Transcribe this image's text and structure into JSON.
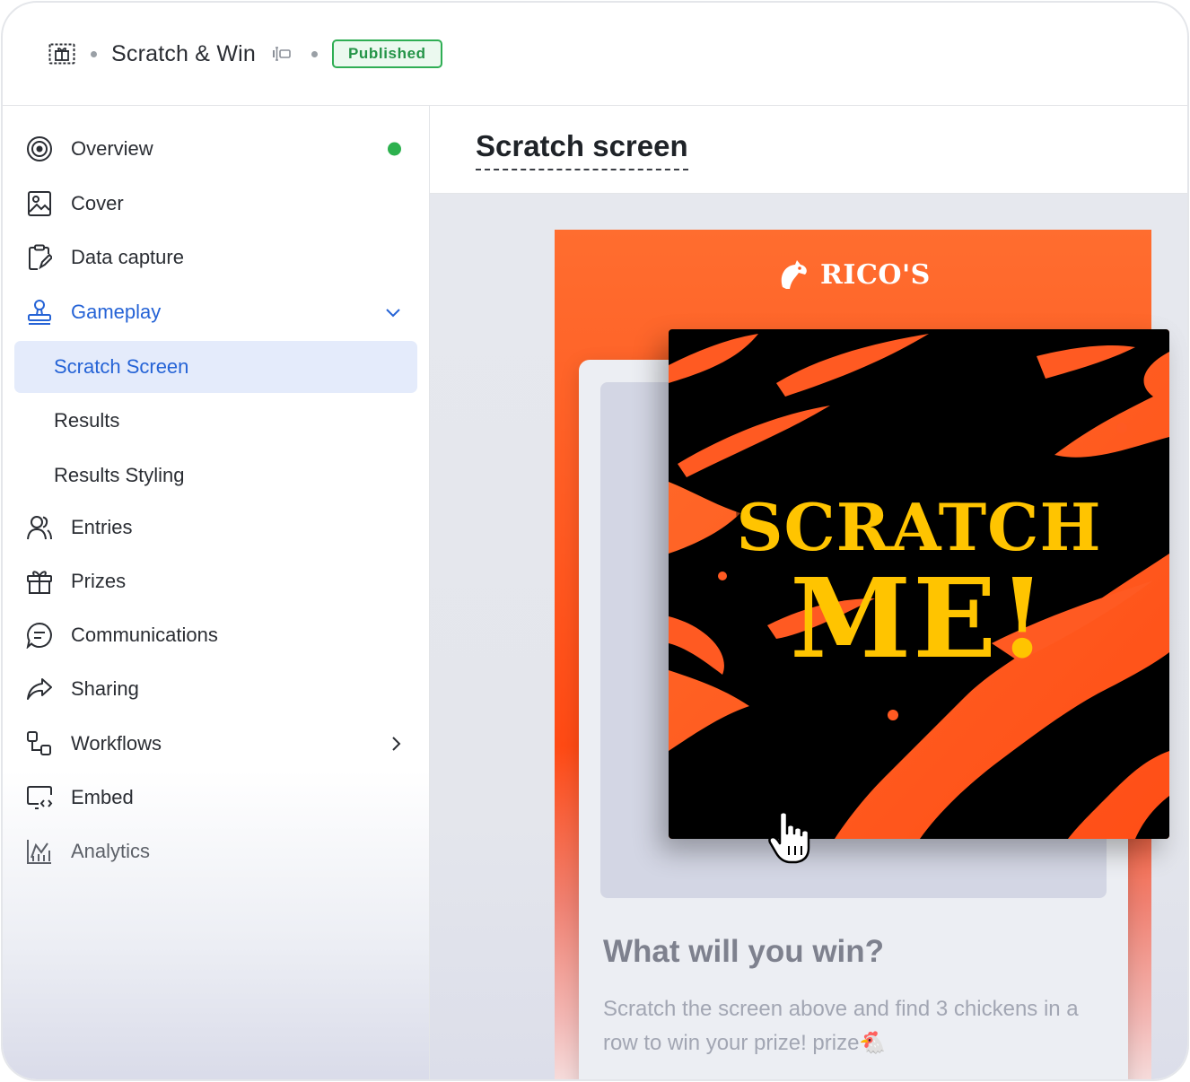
{
  "header": {
    "icon": "gift-card-icon",
    "title": "Scratch & Win",
    "edit_icon": "edit-text-icon",
    "status_badge": "Published",
    "badge_color": "#2fae54"
  },
  "sidebar": {
    "items": [
      {
        "label": "Overview",
        "icon": "target-icon",
        "status": "green-dot"
      },
      {
        "label": "Cover",
        "icon": "image-icon"
      },
      {
        "label": "Data capture",
        "icon": "clipboard-edit-icon"
      },
      {
        "label": "Gameplay",
        "icon": "stamp-icon",
        "expanded": true
      },
      {
        "label": "Entries",
        "icon": "users-icon"
      },
      {
        "label": "Prizes",
        "icon": "gift-icon"
      },
      {
        "label": "Communications",
        "icon": "chat-icon"
      },
      {
        "label": "Sharing",
        "icon": "share-arrow-icon"
      },
      {
        "label": "Workflows",
        "icon": "workflow-icon",
        "has_children": true
      },
      {
        "label": "Embed",
        "icon": "monitor-code-icon"
      },
      {
        "label": "Analytics",
        "icon": "chart-icon"
      }
    ],
    "gameplay_children": [
      "Scratch Screen",
      "Results",
      "Results Styling"
    ],
    "selected": "Scratch Screen",
    "accent": "#2563d6"
  },
  "main": {
    "title": "Scratch screen",
    "preview": {
      "brand": "RICO'S",
      "scratch_line1": "SCRATCH",
      "scratch_line2": "ME!",
      "heading": "What will you win?",
      "description": "Scratch the screen above and find 3 chickens in a row to win your prize! prize🐔",
      "brand_color": "#ff5a22",
      "scratch_text_color": "#ffc400"
    }
  }
}
